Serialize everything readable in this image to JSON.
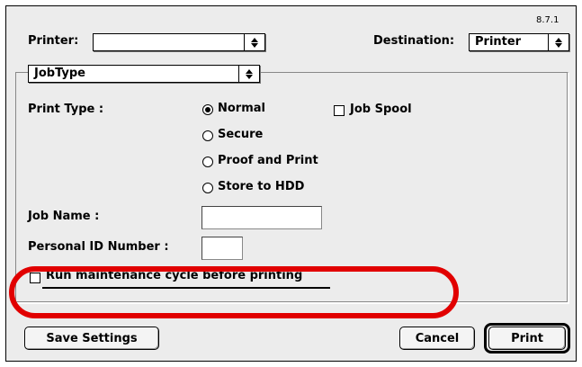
{
  "dialog": {
    "version": "8.7.1",
    "printer_label": "Printer:",
    "printer_value": "",
    "destination_label": "Destination:",
    "destination_value": "Printer",
    "panel_popup_value": "JobType"
  },
  "job_type": {
    "print_type_label": "Print Type :",
    "radio_options": [
      {
        "label": "Normal",
        "selected": true
      },
      {
        "label": "Secure",
        "selected": false
      },
      {
        "label": "Proof and Print",
        "selected": false
      },
      {
        "label": "Store to HDD",
        "selected": false
      }
    ],
    "job_spool_label": "Job Spool",
    "job_spool_checked": false,
    "job_name_label": "Job Name :",
    "job_name_value": "",
    "personal_id_label": "Personal ID Number :",
    "personal_id_value": "",
    "maintenance_label": "Run maintenance cycle before printing",
    "maintenance_checked": false
  },
  "buttons": {
    "save_settings": "Save Settings",
    "cancel": "Cancel",
    "print": "Print"
  },
  "annotation": {
    "color": "#e10000",
    "shape": "ellipse"
  }
}
